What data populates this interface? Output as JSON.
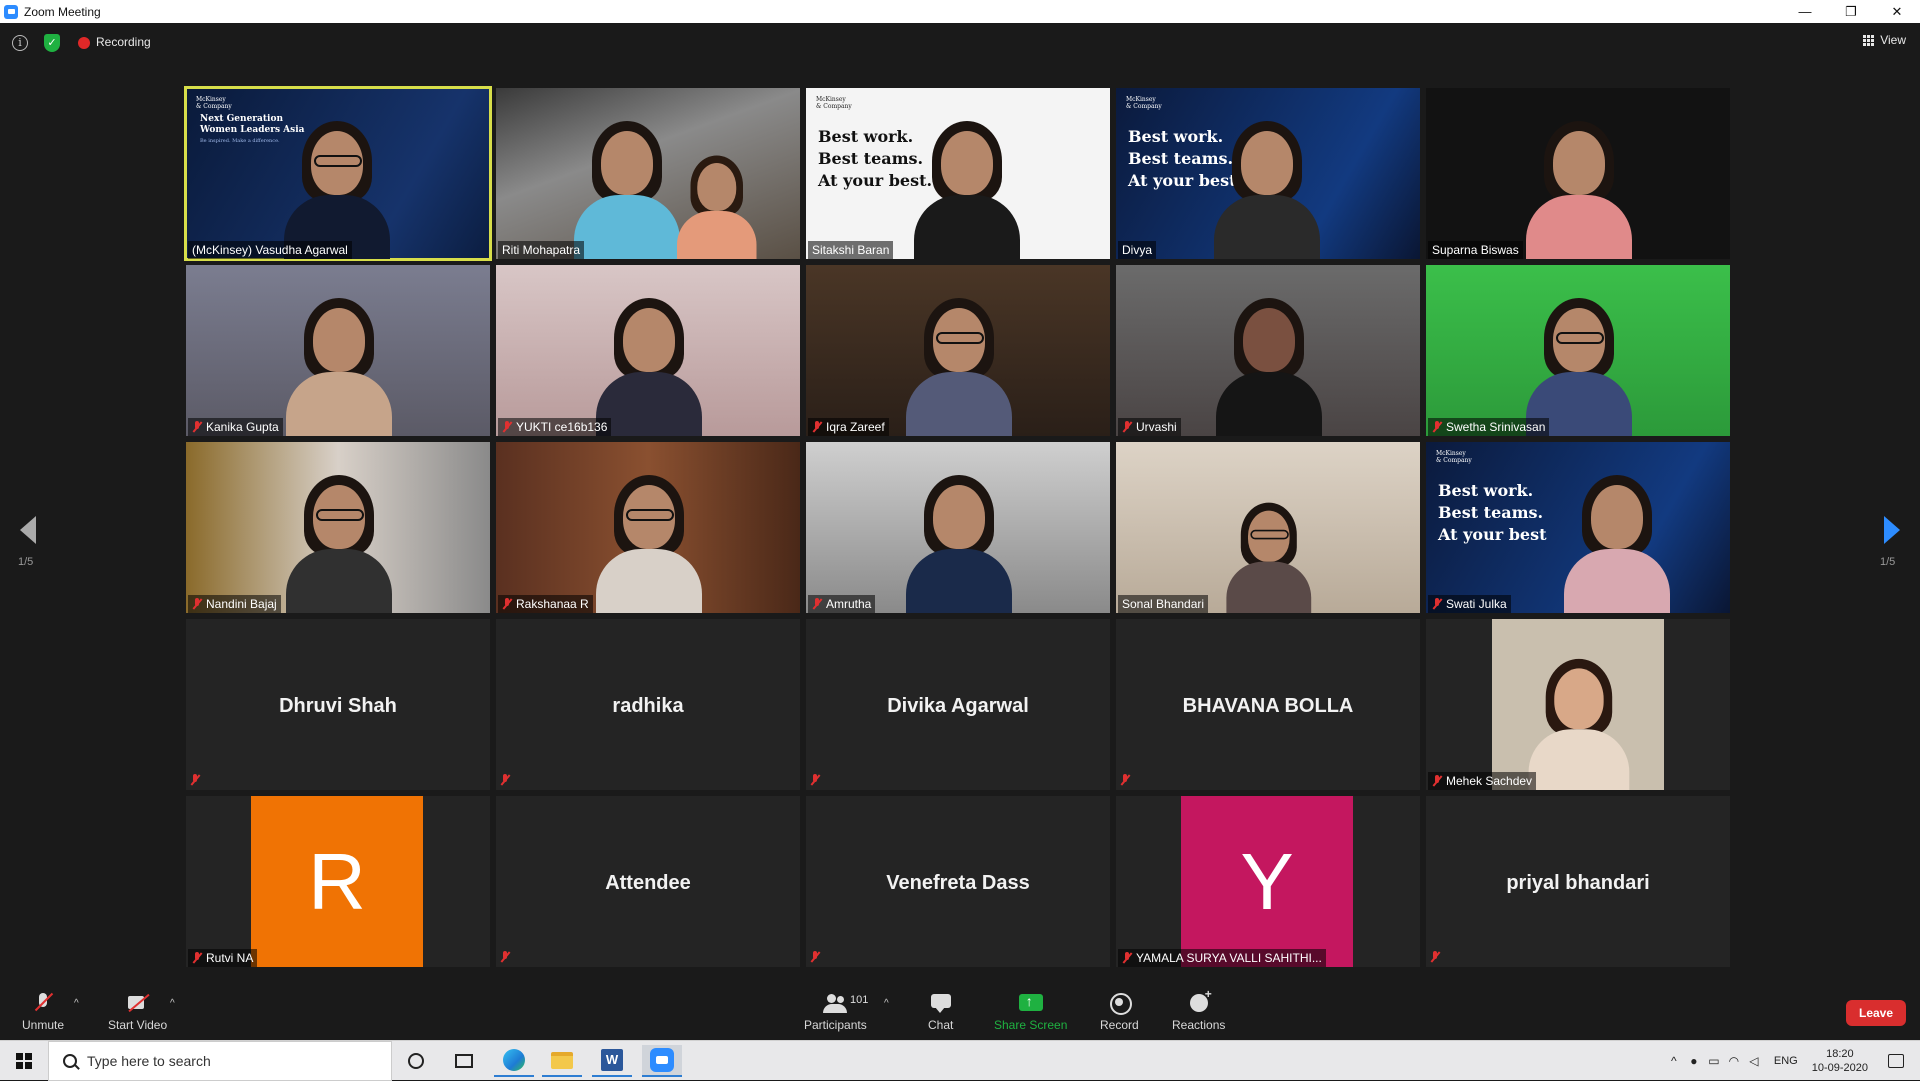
{
  "window": {
    "title": "Zoom Meeting",
    "minimize": "—",
    "restore": "❐",
    "close": "✕"
  },
  "topbar": {
    "info": "i",
    "security": "✓",
    "recording_label": "Recording",
    "view_label": "View"
  },
  "participants": [
    {
      "name": "(McKinsey) Vasudha Agarwal",
      "muted": false,
      "active_speaker": true,
      "tile": "video"
    },
    {
      "name": "Riti Mohapatra",
      "muted": false,
      "tile": "video"
    },
    {
      "name": "Sitakshi Baran",
      "muted": false,
      "tile": "video"
    },
    {
      "name": "Divya",
      "muted": false,
      "tile": "video"
    },
    {
      "name": "Suparna Biswas",
      "muted": false,
      "tile": "video"
    },
    {
      "name": "Kanika Gupta",
      "muted": true,
      "tile": "video"
    },
    {
      "name": "YUKTI ce16b136",
      "muted": true,
      "tile": "video"
    },
    {
      "name": "Iqra Zareef",
      "muted": true,
      "tile": "video"
    },
    {
      "name": "Urvashi",
      "muted": true,
      "tile": "video"
    },
    {
      "name": "Swetha Srinivasan",
      "muted": true,
      "tile": "video"
    },
    {
      "name": "Nandini Bajaj",
      "muted": true,
      "tile": "video"
    },
    {
      "name": "Rakshanaa R",
      "muted": true,
      "tile": "video"
    },
    {
      "name": "Amrutha",
      "muted": true,
      "tile": "video"
    },
    {
      "name": "Sonal Bhandari",
      "muted": false,
      "tile": "video"
    },
    {
      "name": "Swati Julka",
      "muted": true,
      "tile": "video"
    },
    {
      "name": "Dhruvi Shah",
      "muted": true,
      "tile": "name"
    },
    {
      "name": "radhika",
      "muted": true,
      "tile": "name"
    },
    {
      "name": "Divika Agarwal",
      "muted": true,
      "tile": "name"
    },
    {
      "name": "BHAVANA BOLLA",
      "muted": true,
      "tile": "name"
    },
    {
      "name": "Mehek Sachdev",
      "muted": true,
      "tile": "photo"
    },
    {
      "name": "Rutvi NA",
      "muted": true,
      "tile": "avatar",
      "letter": "R",
      "color": "#f07304"
    },
    {
      "name": "Attendee",
      "muted": true,
      "tile": "name"
    },
    {
      "name": "Venefreta Dass",
      "muted": true,
      "tile": "name"
    },
    {
      "name": "YAMALA SURYA VALLI SAHITHI...",
      "muted": true,
      "tile": "avatar",
      "letter": "Y",
      "color": "#c4175f"
    },
    {
      "name": "priyal bhandari",
      "muted": true,
      "tile": "name"
    }
  ],
  "slides": {
    "brand": "McKinsey\n& Company",
    "ngwla": "Next Generation\nWomen Leaders Asia",
    "ngwla_sub": "Be inspired. Make a difference.",
    "best_work": "Best work.\nBest teams.\nAt your best.",
    "best_work_2": "Best work.\nBest teams.\nAt your best"
  },
  "pagination": {
    "left": "1/5",
    "right": "1/5"
  },
  "toolbar": {
    "unmute": "Unmute",
    "start_video": "Start Video",
    "participants": "Participants",
    "participant_count": "101",
    "chat": "Chat",
    "share_screen": "Share Screen",
    "record": "Record",
    "reactions": "Reactions",
    "leave": "Leave",
    "caret": "^"
  },
  "taskbar": {
    "search_placeholder": "Type here to search",
    "word_letter": "W",
    "lang": "ENG",
    "time": "18:20",
    "date": "10-09-2020",
    "tray_up": "^"
  },
  "colors": {
    "accent_blue": "#2d8cff",
    "share_green": "#1fb141",
    "leave_red": "#d92e2e",
    "active_border": "#d7de4a",
    "mute_red": "#e03030"
  }
}
